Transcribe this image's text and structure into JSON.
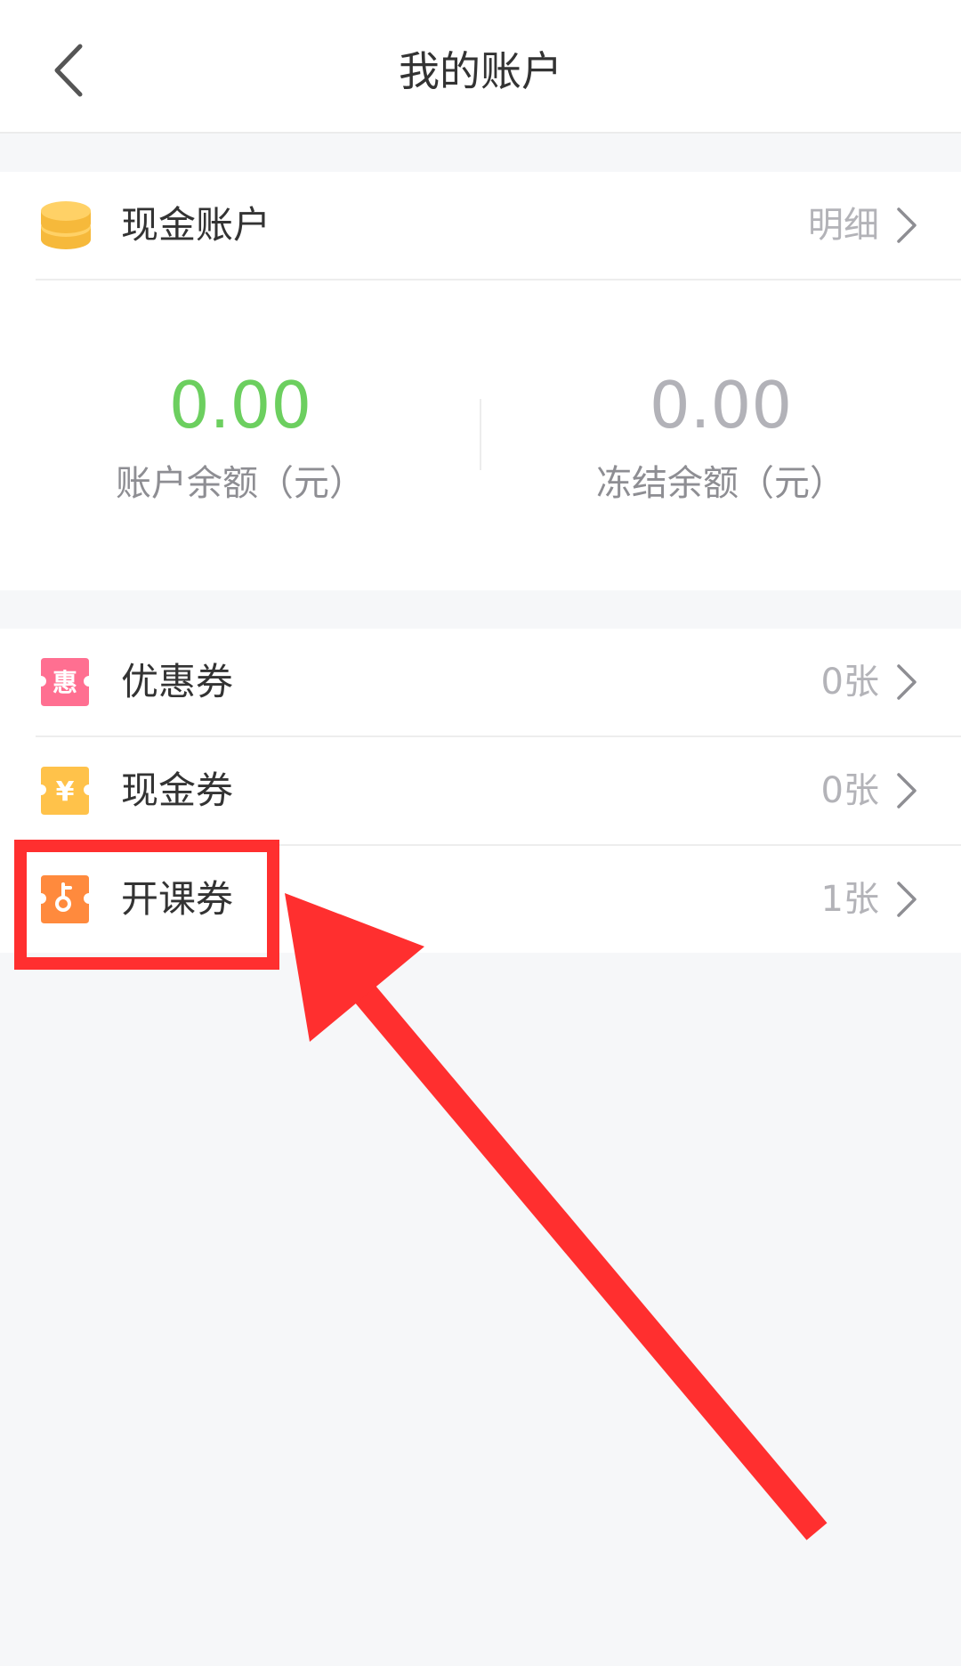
{
  "nav": {
    "title": "我的账户"
  },
  "cash_account": {
    "label": "现金账户",
    "detail_label": "明细",
    "balance": {
      "value": "0.00",
      "caption": "账户余额（元）",
      "color": "#6ccf5f"
    },
    "frozen": {
      "value": "0.00",
      "caption": "冻结余额（元）",
      "color": "#b2b2b8"
    }
  },
  "coupons": [
    {
      "label": "优惠券",
      "count": "0张",
      "icon": "discount-coupon-icon",
      "icon_text": "惠",
      "color": "#ff6f91"
    },
    {
      "label": "现金券",
      "count": "0张",
      "icon": "cash-coupon-icon",
      "icon_text": "¥",
      "color": "#ffc24a"
    },
    {
      "label": "开课券",
      "count": "1张",
      "icon": "course-coupon-icon",
      "icon_text": "",
      "color": "#ff8a3d"
    }
  ],
  "annotation": {
    "highlight_color": "#ff2f2f"
  }
}
